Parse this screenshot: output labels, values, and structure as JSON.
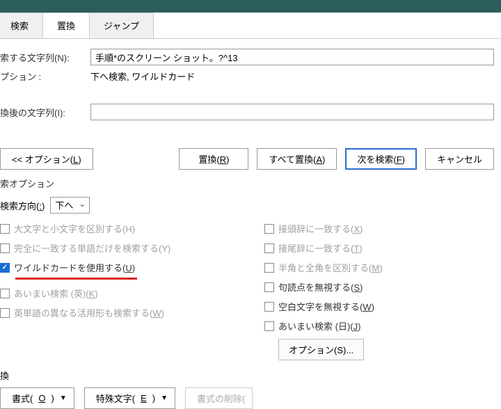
{
  "tabs": {
    "search": "検索",
    "replace": "置換",
    "jump": "ジャンプ"
  },
  "labels": {
    "findWhat": "索する文字列(N):",
    "options": "プション :",
    "replaceWith": "換後の文字列(I):",
    "findWhatUnd": "N",
    "replaceWithUnd": "I"
  },
  "inputs": {
    "findValue": "手順*のスクリーン ショット。?^13",
    "replaceValue": ""
  },
  "optionsText": "下へ検索, ワイルドカード",
  "buttons": {
    "lessOptions": "<< オプション(L)",
    "replace": "置換(R)",
    "replaceAll": "すべて置換(A)",
    "findNext": "次を検索(F)",
    "cancel": "キャンセル",
    "optionsS": "オプション(S)...",
    "format": "書式(O)",
    "special": "特殊文字(E)",
    "noFormat": "書式の削除(",
    "lessUnd": "L",
    "replaceUnd": "R",
    "replaceAllUnd": "A",
    "findNextUnd": "F",
    "formatUnd": "O",
    "specialUnd": "E"
  },
  "group": {
    "searchOptions": "索オプション",
    "direction": "検索方向(:)",
    "directionUnd": ":",
    "directionValue": "下へ",
    "replaceSection": "換"
  },
  "checks": {
    "matchCase": "大文字と小文字を区別する(H)",
    "wholeWord": "完全に一致する単語だけを検索する(Y)",
    "wildcards": "ワイルドカードを使用する(U)",
    "wildcardsUnd": "U",
    "fuzzyEn": "あいまい検索 (英)(K)",
    "fuzzyEnUnd": "K",
    "wordForms": "英単語の異なる活用形も検索する(W)",
    "wordFormsUnd": "W",
    "prefix": "接頭辞に一致する(X)",
    "prefixUnd": "X",
    "suffix": "接尾辞に一致する(T)",
    "suffixUnd": "T",
    "halfFull": "半角と全角を区別する(M)",
    "halfFullUnd": "M",
    "punct": "句読点を無視する(S)",
    "punctUnd": "S",
    "whitespace": "空白文字を無視する(W)",
    "whitespaceUnd": "W",
    "fuzzyJa": "あいまい検索 (日)(J)",
    "fuzzyJaUnd": "J"
  }
}
